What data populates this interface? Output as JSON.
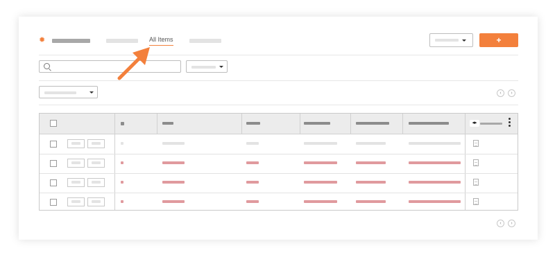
{
  "header": {
    "active_tab_label": "All Items",
    "add_button_symbol": "+",
    "add_button_color": "#f3803c"
  },
  "icons": {
    "settings": "gear-icon",
    "search": "search-icon",
    "pagination_prev": "chevron-left-icon",
    "pagination_next": "chevron-right-icon",
    "column_resize": "resize-arrows-icon",
    "more": "kebab-menu-icon",
    "attachment": "pdf-icon"
  },
  "pagination": {
    "prev_symbol": "‹",
    "next_symbol": "›"
  },
  "table": {
    "row_count": 4,
    "highlight_color": "#e09a9e"
  },
  "annotation": {
    "arrow_color": "#f3803c"
  }
}
